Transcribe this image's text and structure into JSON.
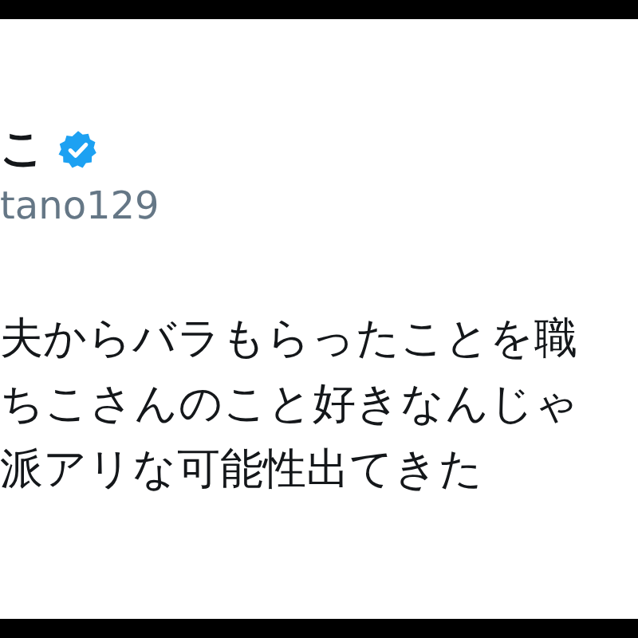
{
  "tweet": {
    "author_name": "こ",
    "verified": true,
    "handle": "tano129",
    "text_lines": [
      "夫からバラもらったことを職",
      "ちこさんのこと好きなんじゃ",
      "派アリな可能性出てきた"
    ]
  }
}
